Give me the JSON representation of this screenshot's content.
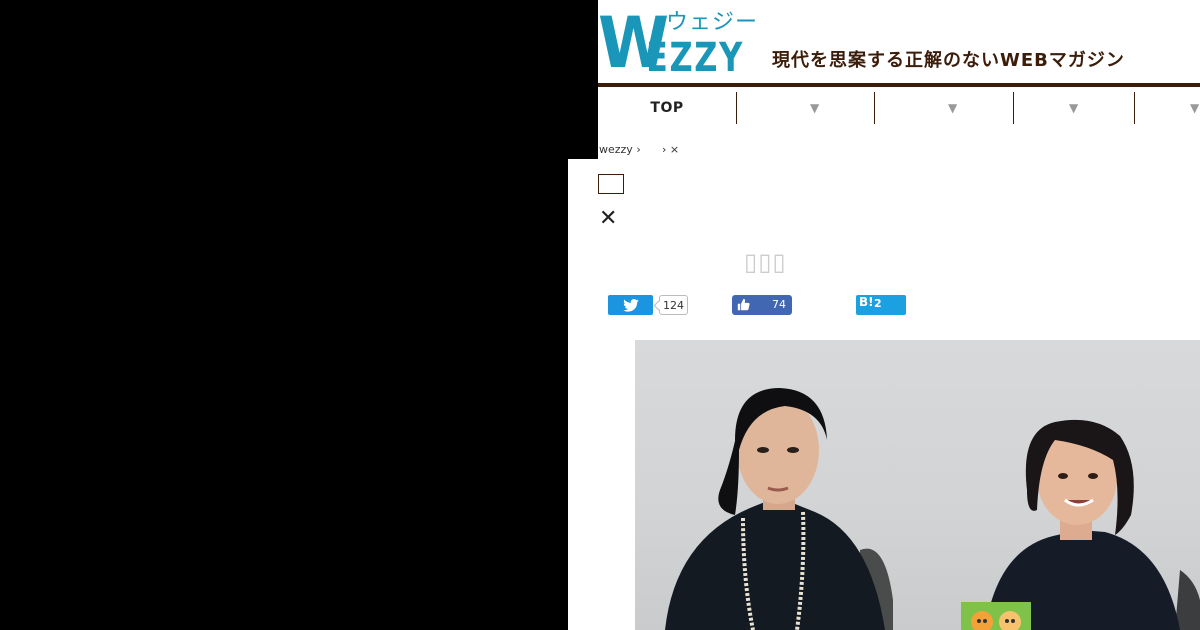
{
  "header": {
    "logo_w": "W",
    "logo_rest": "EZZY",
    "logo_kana": "ウェジー",
    "tagline": "現代を思案する正解のないWEBマガジン"
  },
  "nav": {
    "items": [
      {
        "label": "TOP"
      },
      {
        "label": "",
        "arrow": "▼"
      },
      {
        "label": "",
        "arrow": "▼"
      },
      {
        "label": "",
        "arrow": "▼"
      },
      {
        "label": "",
        "arrow": "▼"
      }
    ]
  },
  "breadcrumb": {
    "home": "wezzy ›",
    "current": "› ×"
  },
  "article": {
    "close_symbol": "✕",
    "title_placeholder": "▯▯▯"
  },
  "share": {
    "twitter_count": "124",
    "facebook_count": "74",
    "hatena_logo": "B!",
    "hatena_count": "2"
  },
  "colors": {
    "brand_teal": "#1a97b8",
    "brand_brown": "#3b1d0a",
    "twitter": "#1b95e0",
    "facebook": "#4267b2",
    "hatena": "#1ba0e1"
  }
}
